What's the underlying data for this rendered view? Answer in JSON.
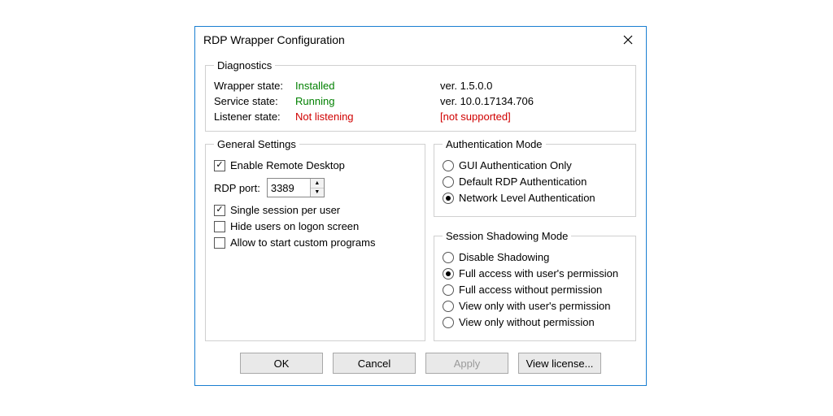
{
  "window": {
    "title": "RDP Wrapper Configuration"
  },
  "diag": {
    "legend": "Diagnostics",
    "wrapper_label": "Wrapper state:",
    "wrapper_value": "Installed",
    "wrapper_ver": "ver. 1.5.0.0",
    "service_label": "Service state:",
    "service_value": "Running",
    "service_ver": "ver. 10.0.17134.706",
    "listener_label": "Listener state:",
    "listener_value": "Not listening",
    "listener_ver": "[not supported]"
  },
  "general": {
    "legend": "General Settings",
    "enable": "Enable Remote Desktop",
    "port_label": "RDP port:",
    "port_value": "3389",
    "single": "Single session per user",
    "hide": "Hide users on logon screen",
    "allow": "Allow to start custom programs"
  },
  "auth": {
    "legend": "Authentication Mode",
    "gui": "GUI Authentication Only",
    "default": "Default RDP Authentication",
    "nla": "Network Level Authentication"
  },
  "shadow": {
    "legend": "Session Shadowing Mode",
    "disable": "Disable Shadowing",
    "full_perm": "Full access with user's permission",
    "full_noperm": "Full access without permission",
    "view_perm": "View only with user's permission",
    "view_noperm": "View only without permission"
  },
  "buttons": {
    "ok": "OK",
    "cancel": "Cancel",
    "apply": "Apply",
    "license": "View license..."
  }
}
